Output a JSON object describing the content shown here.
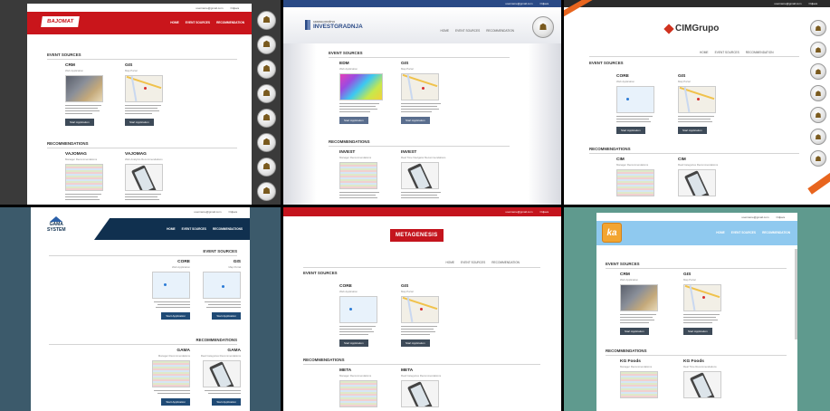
{
  "colors": {
    "bajomat_red": "#c9151b",
    "investgradnja_blue": "#2a4a86",
    "cim_orange": "#e8651e",
    "gama_navy": "#10304f",
    "metagenesis_red": "#c4141d",
    "ka_sky": "#8fc9ef",
    "button_dark": "#3d4a58",
    "backdrop_slate": "#3c5a6b",
    "backdrop_teal": "#5f9a8e"
  },
  "common": {
    "event_sources": "EVENT SOURCES",
    "recommendations": "RECOMMENDATIONS",
    "home": "HOME",
    "nav_event_sources": "EVENT SOURCES",
    "nav_recommendation": "RECOMMENDATION",
    "nav_recommendations": "RECOMMENDATIONS",
    "start_application": "Start Application",
    "email": "username@gmail.com",
    "logout": "Odjava"
  },
  "panels": {
    "bajomat": {
      "logo": "BAJOMAT",
      "cards_top": [
        {
          "title": "CRM",
          "subtitle": "Web Application"
        },
        {
          "title": "GIS",
          "subtitle": "Map Portal"
        }
      ],
      "cards_bottom": [
        {
          "title": "VAJOMAG",
          "subtitle": "Manager Recommendations"
        },
        {
          "title": "VAJOMAG",
          "subtitle": "Web Analytics Recommendations"
        }
      ]
    },
    "investgradnja": {
      "logo": "INVESTGRADNJA",
      "logo_small": "GRADNJA DRUŠTVO",
      "cards_top": [
        {
          "title": "EDM",
          "subtitle": "Web Application"
        },
        {
          "title": "GIS",
          "subtitle": "Map Portal"
        }
      ],
      "cards_bottom": [
        {
          "title": "INVEST",
          "subtitle": "Manager Recommendations"
        },
        {
          "title": "INVEST",
          "subtitle": "Real Time Navigator Recommendations"
        }
      ]
    },
    "cim": {
      "logo": "CIMGrupo",
      "cards_top": [
        {
          "title": "CORE",
          "subtitle": "Web Application"
        },
        {
          "title": "GIS",
          "subtitle": "Map Portal"
        }
      ],
      "cards_bottom": [
        {
          "title": "CIM",
          "subtitle": "Manager Recommendations"
        },
        {
          "title": "CIM",
          "subtitle": "Real Categories Recommendations"
        }
      ]
    },
    "gama": {
      "logo_line1": "GAMA",
      "logo_line2": "SYSTEM",
      "cards_top": [
        {
          "title": "CORE",
          "subtitle": "Web Application"
        },
        {
          "title": "GIS",
          "subtitle": "Map Portal"
        }
      ],
      "cards_bottom": [
        {
          "title": "GAMA",
          "subtitle": "Manager Recommendations"
        },
        {
          "title": "GAMA",
          "subtitle": "Real Categories Recommendations"
        }
      ]
    },
    "metagenesis": {
      "logo": "METAGENESIS",
      "cards_top": [
        {
          "title": "CORE",
          "subtitle": "Web Application"
        },
        {
          "title": "GIS",
          "subtitle": "Map Portal"
        }
      ],
      "cards_bottom": [
        {
          "title": "META",
          "subtitle": "Manager Recommendations"
        },
        {
          "title": "META",
          "subtitle": "Real Categories Recommendations"
        }
      ]
    },
    "ka": {
      "logo": "ka",
      "cards_top": [
        {
          "title": "CRM",
          "subtitle": "Web Application"
        },
        {
          "title": "GIS",
          "subtitle": "Map Portal"
        }
      ],
      "cards_bottom": [
        {
          "title": "KG Foods",
          "subtitle": "Manager Recommendations"
        },
        {
          "title": "KG Foods",
          "subtitle": "Real Time Recommendations"
        }
      ]
    }
  }
}
